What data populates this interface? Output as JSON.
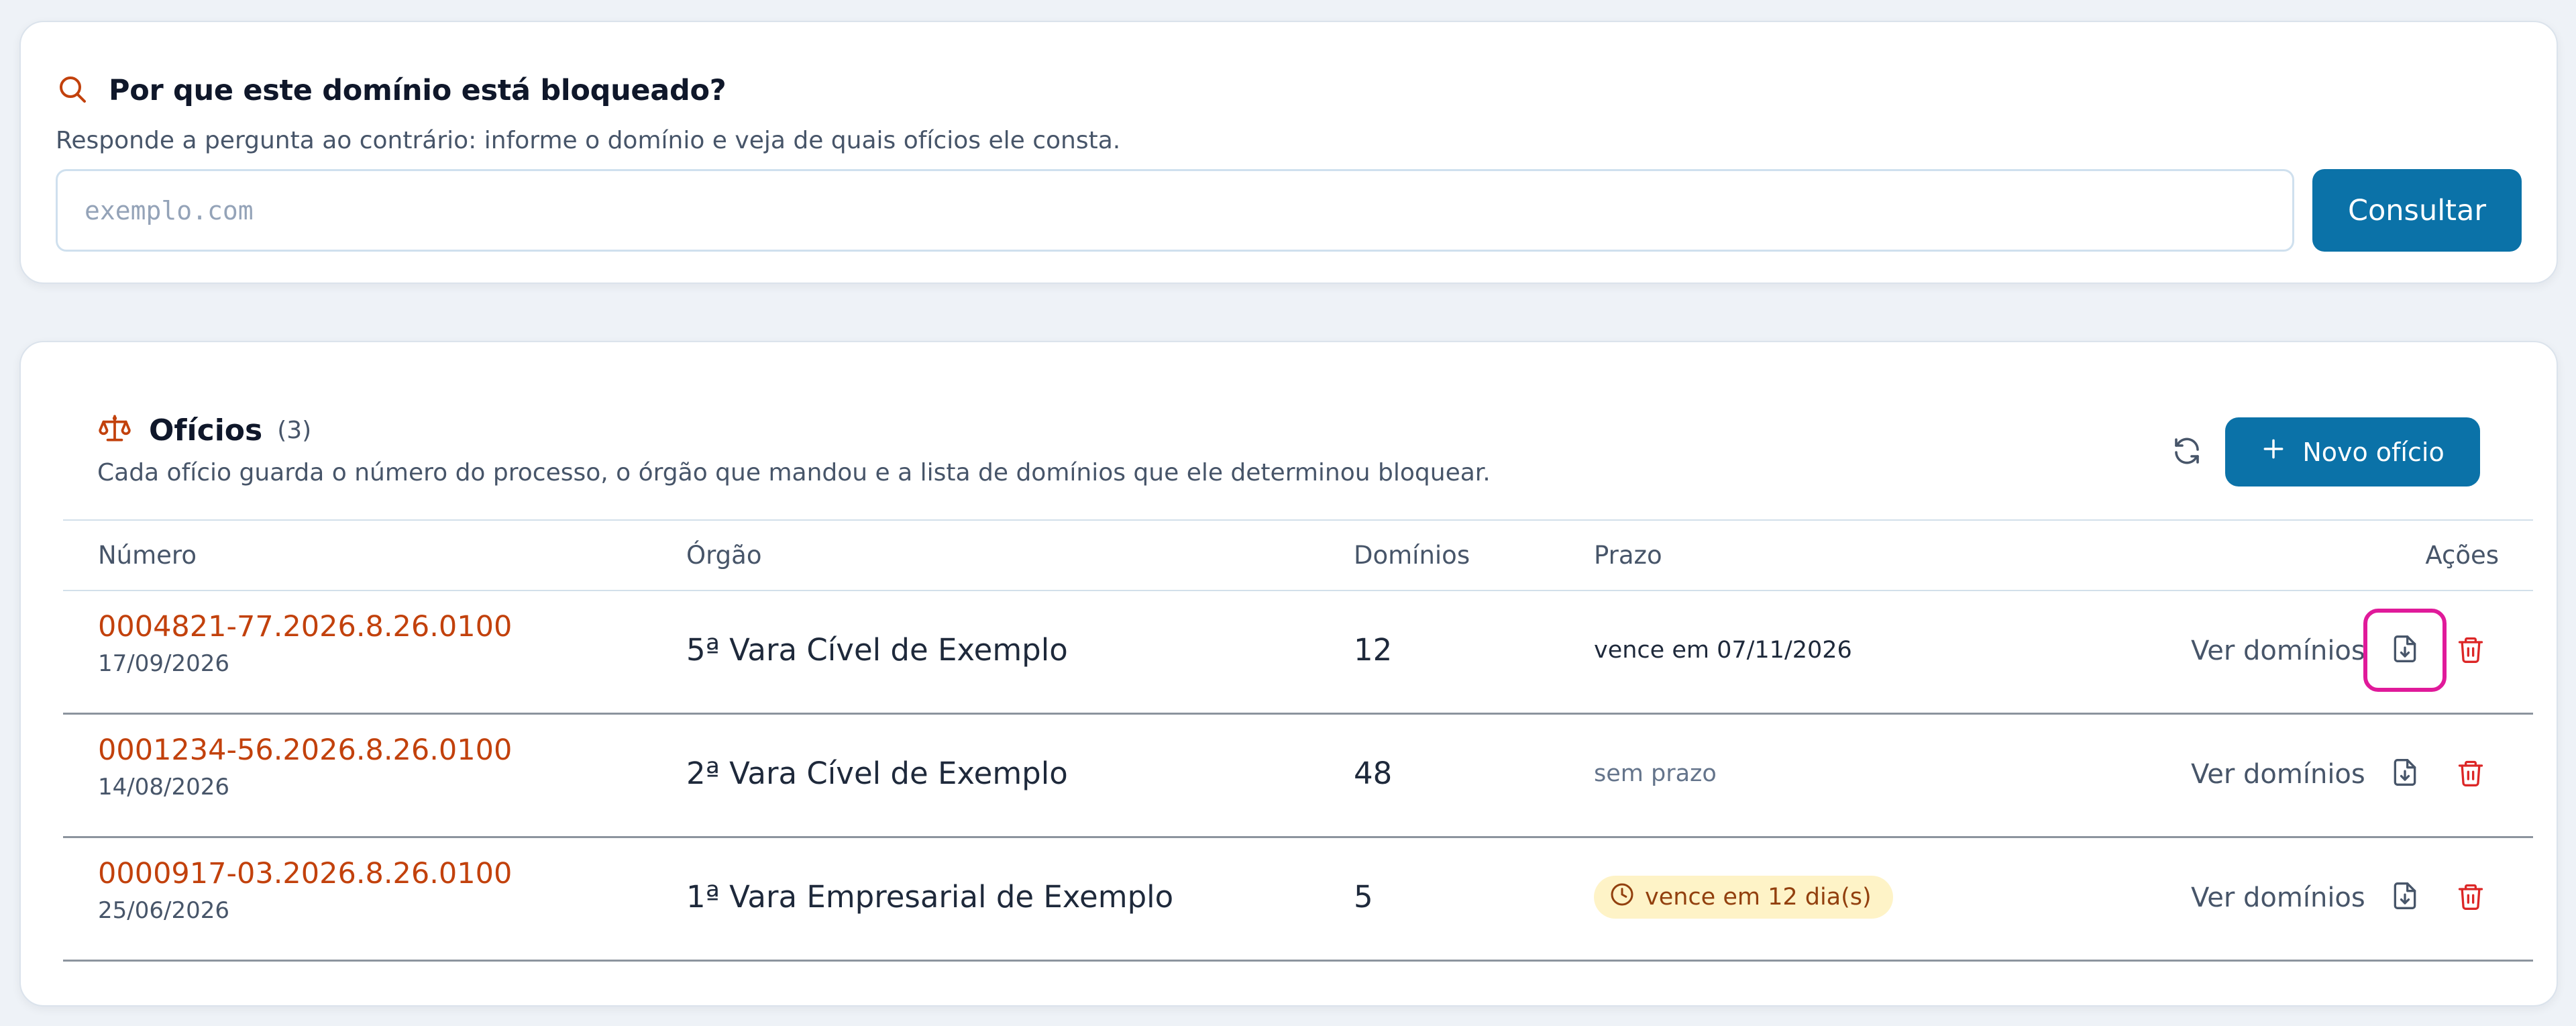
{
  "lookup": {
    "title": "Por que este domínio está bloqueado?",
    "description": "Responde a pergunta ao contrário: informe o domínio e veja de quais ofícios ele consta.",
    "input_placeholder": "exemplo.com",
    "input_value": "",
    "button_label": "Consultar",
    "icon": "search-icon"
  },
  "oficios": {
    "title": "Ofícios",
    "count": "(3)",
    "description": "Cada ofício guarda o número do processo, o órgão que mandou e a lista de domínios que ele determinou bloquear.",
    "icon": "scales-icon",
    "refresh_icon": "refresh-icon",
    "new_button_label": "Novo ofício",
    "columns": {
      "numero": "Número",
      "orgao": "Órgão",
      "dominios": "Domínios",
      "prazo": "Prazo",
      "acoes": "Ações"
    },
    "rows": [
      {
        "numero": "0004821-77.2026.8.26.0100",
        "data": "17/09/2026",
        "orgao": "5ª Vara Cível de Exemplo",
        "dominios": "12",
        "prazo": "vence em 07/11/2026",
        "prazo_style": "plain",
        "ver_label": "Ver domínios",
        "export_focused": true
      },
      {
        "numero": "0001234-56.2026.8.26.0100",
        "data": "14/08/2026",
        "orgao": "2ª Vara Cível de Exemplo",
        "dominios": "48",
        "prazo": "sem prazo",
        "prazo_style": "muted",
        "ver_label": "Ver domínios",
        "export_focused": false
      },
      {
        "numero": "0000917-03.2026.8.26.0100",
        "data": "25/06/2026",
        "orgao": "1ª Vara Empresarial de Exemplo",
        "dominios": "5",
        "prazo": "vence em 12 dia(s)",
        "prazo_style": "warning-badge",
        "ver_label": "Ver domínios",
        "export_focused": false
      }
    ]
  },
  "colors": {
    "accent": "#0b72a8",
    "link": "#c2410c",
    "danger": "#dc2626",
    "warning_bg": "#fef3c7",
    "warning_text": "#92400e",
    "focus_ring": "#e01a9a",
    "page_bg": "#eef2f7"
  }
}
